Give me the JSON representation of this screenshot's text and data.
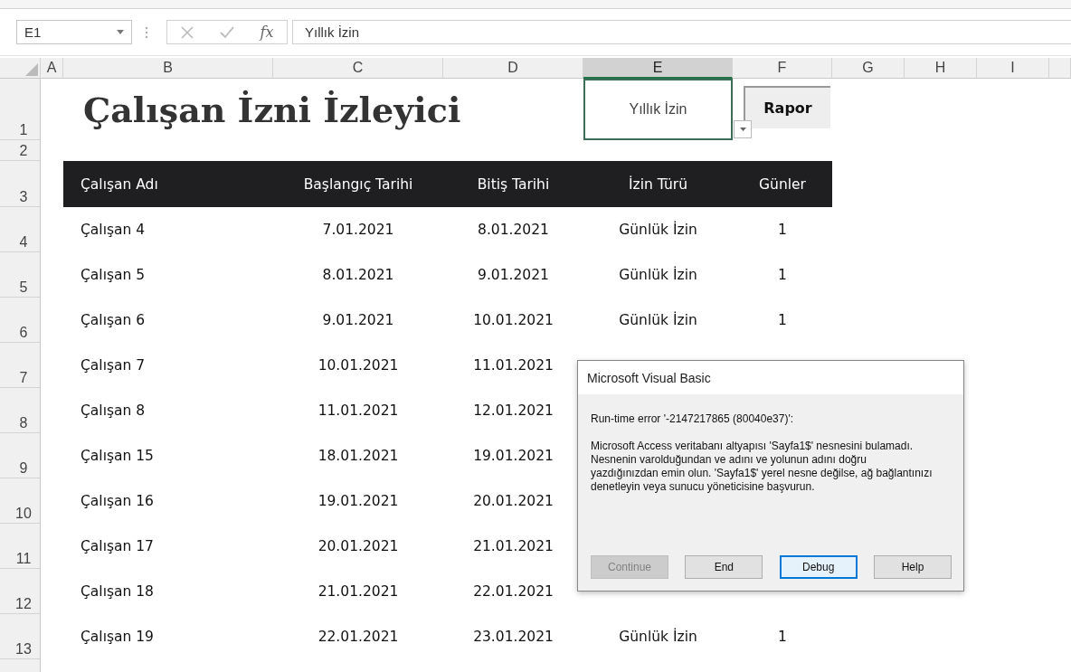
{
  "formula_bar": {
    "name_box": "E1",
    "function_symbol": "fx",
    "value": "Yıllık İzin"
  },
  "columns": [
    {
      "label": "A",
      "selected": false
    },
    {
      "label": "B",
      "selected": false
    },
    {
      "label": "C",
      "selected": false
    },
    {
      "label": "D",
      "selected": false
    },
    {
      "label": "E",
      "selected": true
    },
    {
      "label": "F",
      "selected": false
    },
    {
      "label": "G",
      "selected": false
    },
    {
      "label": "H",
      "selected": false
    },
    {
      "label": "I",
      "selected": false
    }
  ],
  "row_numbers": [
    "1",
    "2",
    "3",
    "4",
    "5",
    "6",
    "7",
    "8",
    "9",
    "10",
    "11",
    "12",
    "13"
  ],
  "title": "Çalışan İzni İzleyici",
  "leave_type": {
    "value": "Yıllık İzin",
    "selected": true
  },
  "report_button": "Rapor",
  "table": {
    "columns": [
      "Çalışan Adı",
      "Başlangıç Tarihi",
      "Bitiş Tarihi",
      "İzin Türü",
      "Günler"
    ],
    "rows": [
      [
        "Çalışan 4",
        "7.01.2021",
        "8.01.2021",
        "Günlük İzin",
        "1"
      ],
      [
        "Çalışan 5",
        "8.01.2021",
        "9.01.2021",
        "Günlük İzin",
        "1"
      ],
      [
        "Çalışan 6",
        "9.01.2021",
        "10.01.2021",
        "Günlük İzin",
        "1"
      ],
      [
        "Çalışan 7",
        "10.01.2021",
        "11.01.2021"
      ],
      [
        "Çalışan 8",
        "11.01.2021",
        "12.01.2021"
      ],
      [
        "Çalışan 15",
        "18.01.2021",
        "19.01.2021"
      ],
      [
        "Çalışan 16",
        "19.01.2021",
        "20.01.2021"
      ],
      [
        "Çalışan 17",
        "20.01.2021",
        "21.01.2021"
      ],
      [
        "Çalışan 18",
        "21.01.2021",
        "22.01.2021"
      ],
      [
        "Çalışan 19",
        "22.01.2021",
        "23.01.2021",
        "Günlük İzin",
        "1"
      ]
    ]
  },
  "dialog": {
    "title": "Microsoft Visual Basic",
    "error": "Run-time error '-2147217865 (80040e37)':",
    "message": "Microsoft Access veritabanı altyapısı 'Sayfa1$' nesnesini bulamadı. Nesnenin varolduğundan ve adını ve yolunun adını doğru yazdığınızdan emin olun. 'Sayfa1$' yerel nesne değilse, ağ bağlantınızı denetleyin veya sunucu yöneticisine başvurun.",
    "buttons": [
      {
        "label": "Continue",
        "disabled": true,
        "selected": false
      },
      {
        "label": "End",
        "disabled": false,
        "selected": false
      },
      {
        "label": "Debug",
        "disabled": false,
        "selected": true
      },
      {
        "label": "Help",
        "disabled": false,
        "selected": false
      }
    ]
  }
}
